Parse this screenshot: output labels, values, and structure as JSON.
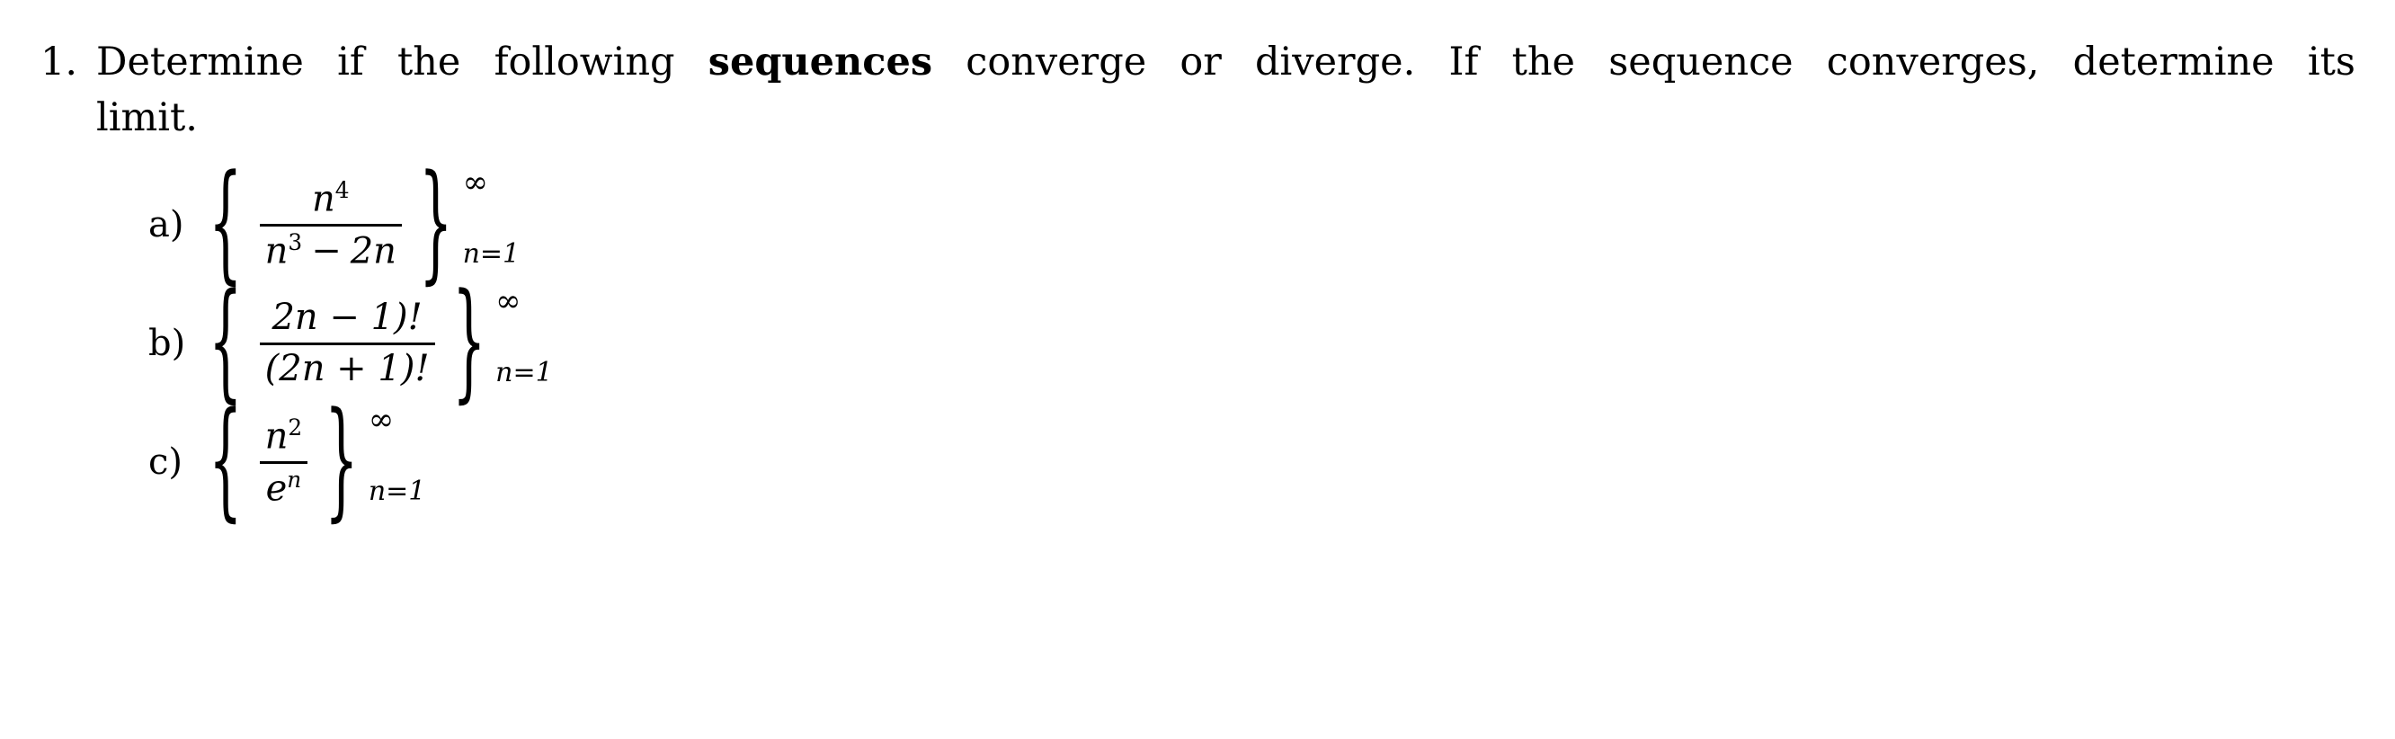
{
  "document": {
    "background_color": "#ffffff",
    "text_color": "#000000",
    "problem_number": "1.",
    "statement": {
      "line1_words": [
        "Determine",
        "if",
        "the",
        "following",
        "sequences",
        "converge",
        "or",
        "diverge.",
        "If",
        "the",
        "sequence",
        "converges,",
        "determine",
        "its"
      ],
      "line1_bold_word": "sequences",
      "line1_plain_prefix": "Determine if the following",
      "line1_plain_suffix": "converge or diverge.  If the sequence converges, determine its",
      "line2": "limit."
    },
    "parts": [
      {
        "label": "a)",
        "numerator": "n",
        "numerator_exponent": "4",
        "denominator_base1": "n",
        "denominator_exponent1": "3",
        "denominator_operator": "−",
        "denominator_tail": "2n",
        "denominator_full": "n3 − 2n",
        "open_brace": "{",
        "close_brace": "}",
        "superscript": "∞",
        "subscript": "n=1",
        "expression_text": "{ n^4 / (n^3 − 2n) }_{n=1}^{∞}"
      },
      {
        "label": "b)",
        "numerator": "2n − 1)!",
        "denominator": "(2n + 1)!",
        "open_brace": "{",
        "close_brace": "}",
        "superscript": "∞",
        "subscript": "n=1",
        "expression_text": "{ 2n − 1)! / (2n + 1)! }_{n=1}^{∞}"
      },
      {
        "label": "c)",
        "numerator_base": "n",
        "numerator_exponent": "2",
        "denominator_base": "e",
        "denominator_exponent": "n",
        "open_brace": "{",
        "close_brace": "}",
        "superscript": "∞",
        "subscript": "n=1",
        "expression_text": "{ n^2 / e^n }_{n=1}^{∞}"
      }
    ]
  }
}
